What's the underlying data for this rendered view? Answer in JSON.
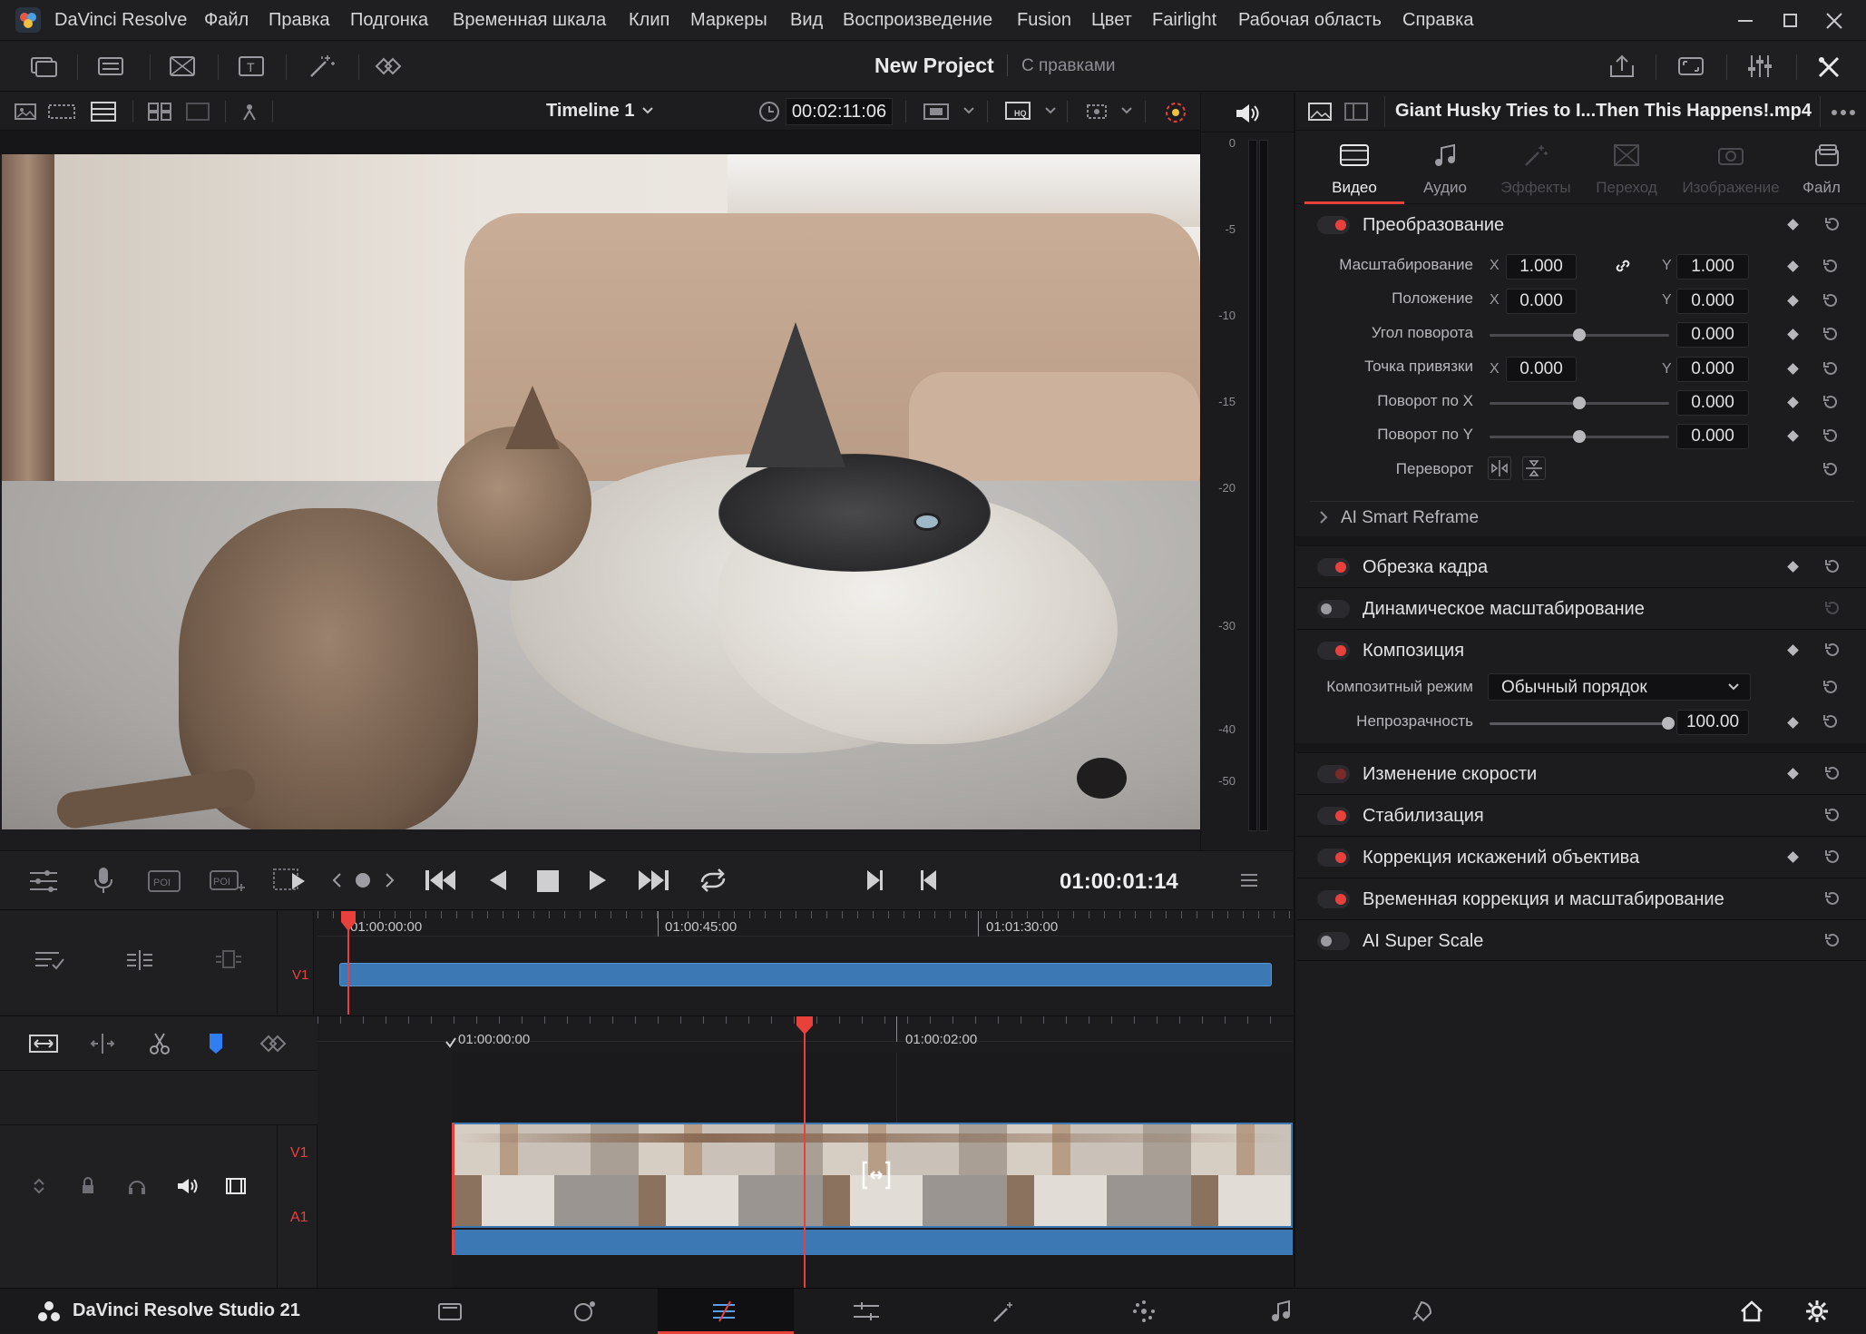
{
  "app": {
    "name": "DaVinci Resolve",
    "bottom_brand": "DaVinci Resolve Studio 21"
  },
  "menu": [
    "Файл",
    "Правка",
    "Подгонка",
    "Временная шкала",
    "Клип",
    "Маркеры",
    "Вид",
    "Воспроизведение",
    "Fusion",
    "Цвет",
    "Fairlight",
    "Рабочая область",
    "Справка"
  ],
  "project": {
    "name": "New Project",
    "status": "С правками"
  },
  "viewer": {
    "timeline_name": "Timeline 1",
    "source_timecode": "00:02:11:06",
    "playhead_timecode": "01:00:01:14"
  },
  "audio_meter": {
    "scale": [
      "0",
      "-5",
      "-10",
      "-15",
      "-20",
      "-30",
      "-40",
      "-50"
    ]
  },
  "upper_timeline": {
    "track": "V1",
    "ticks": [
      "01:00:00:00",
      "01:00:45:00",
      "01:01:30:00"
    ]
  },
  "lower_timeline": {
    "tracks": [
      "V1",
      "A1"
    ],
    "ticks": [
      "01:00:00:00",
      "01:00:02:00"
    ]
  },
  "inspector": {
    "clip_name": "Giant Husky Tries to I...Then This Happens!.mp4",
    "tabs": [
      {
        "label": "Видео",
        "active": true
      },
      {
        "label": "Аудио",
        "active": false
      },
      {
        "label": "Эффекты",
        "active": false,
        "disabled": true
      },
      {
        "label": "Переход",
        "active": false,
        "disabled": true
      },
      {
        "label": "Изображение",
        "active": false,
        "disabled": true
      },
      {
        "label": "Файл",
        "active": false
      }
    ],
    "transform": {
      "title": "Преобразование",
      "zoom": {
        "label": "Масштабирование",
        "x": "1.000",
        "y": "1.000"
      },
      "position": {
        "label": "Положение",
        "x": "0.000",
        "y": "0.000"
      },
      "rotation": {
        "label": "Угол поворота",
        "value": "0.000"
      },
      "anchor": {
        "label": "Точка привязки",
        "x": "0.000",
        "y": "0.000"
      },
      "pitch": {
        "label": "Поворот по X",
        "value": "0.000"
      },
      "yaw": {
        "label": "Поворот по Y",
        "value": "0.000"
      },
      "flip": {
        "label": "Переворот"
      },
      "x_lbl": "X",
      "y_lbl": "Y"
    },
    "ai_reframe": "AI Smart Reframe",
    "sections": [
      {
        "title": "Обрезка кадра",
        "on": true
      },
      {
        "title": "Динамическое масштабирование",
        "on": false
      },
      {
        "title": "Композиция",
        "on": true
      }
    ],
    "composite": {
      "mode_label": "Композитный режим",
      "mode_value": "Обычный порядок",
      "opacity_label": "Непрозрачность",
      "opacity_value": "100.00"
    },
    "more_sections": [
      {
        "title": "Изменение скорости",
        "on": true,
        "dim": true
      },
      {
        "title": "Стабилизация",
        "on": true
      },
      {
        "title": "Коррекция искажений объектива",
        "on": true
      },
      {
        "title": "Временная коррекция и масштабирование",
        "on": true
      },
      {
        "title": "AI Super Scale",
        "on": false
      }
    ]
  },
  "colors": {
    "accent_red": "#e8413c",
    "clip_blue": "#3c78b4",
    "bg": "#1c1c1f"
  }
}
